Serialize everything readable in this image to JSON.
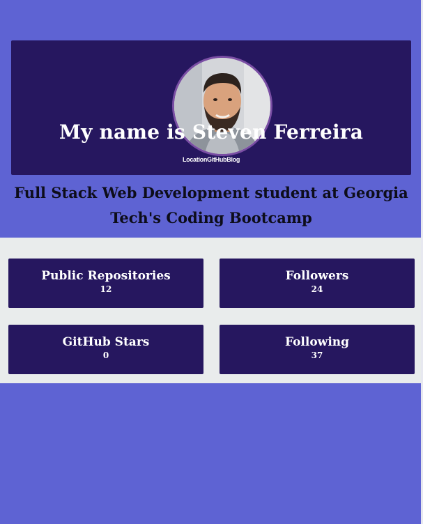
{
  "profile": {
    "name_heading": "My name is Steven Ferreira",
    "links": {
      "location": "Location",
      "github": "GitHub",
      "blog": "Blog"
    },
    "bio": "Full Stack Web Development student at Georgia Tech's Coding Bootcamp"
  },
  "stats": {
    "repos": {
      "label": "Public Repositories",
      "value": "12"
    },
    "followers": {
      "label": "Followers",
      "value": "24"
    },
    "stars": {
      "label": "GitHub Stars",
      "value": "0"
    },
    "following": {
      "label": "Following",
      "value": "37"
    }
  },
  "colors": {
    "page_background": "#5e63d3",
    "card_background": "#26175f",
    "stats_background": "#e9ecec",
    "avatar_border": "#7a4ea4"
  }
}
